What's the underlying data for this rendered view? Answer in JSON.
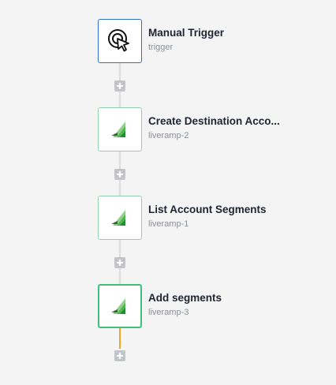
{
  "workflow": {
    "steps": [
      {
        "title": "Manual Trigger",
        "subtitle": "trigger",
        "icon": "cursor-click-icon"
      },
      {
        "title": "Create Destination Acco...",
        "subtitle": "liveramp-2",
        "icon": "liveramp-icon"
      },
      {
        "title": "List Account Segments",
        "subtitle": "liveramp-1",
        "icon": "liveramp-icon"
      },
      {
        "title": "Add segments",
        "subtitle": "liveramp-3",
        "icon": "liveramp-icon"
      }
    ],
    "colors": {
      "trigger_border": "#2f6fd0",
      "step_border": "#8fd3ad",
      "selected_border": "#3ec07a",
      "active_connector": "#f5a623",
      "add_button": "#c3c3ca"
    }
  }
}
